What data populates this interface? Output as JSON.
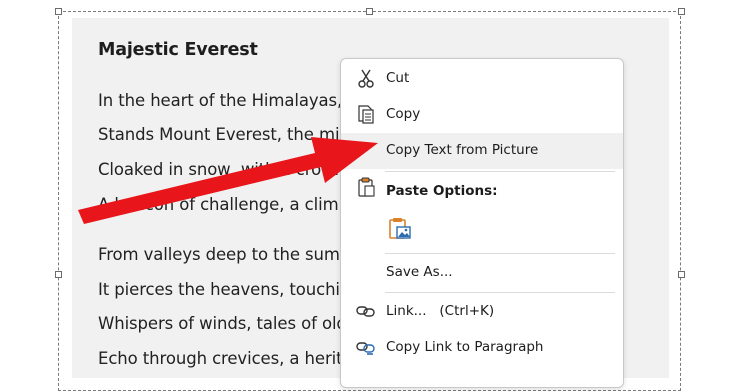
{
  "document": {
    "title": "Majestic Everest",
    "stanza1": [
      "In the heart of the Himalayas, where the",
      "Stands Mount Everest, the mighty",
      "Cloaked in snow, with a crown",
      "A beacon of challenge, a climb"
    ],
    "stanza2": [
      "From valleys deep to the summit",
      "It pierces the heavens, touching",
      "Whispers of winds, tales of old",
      "Echo through crevices, a heritage"
    ]
  },
  "context_menu": {
    "cut": {
      "label": "Cut",
      "icon": "scissors-icon"
    },
    "copy": {
      "label": "Copy",
      "icon": "copy-icon"
    },
    "copy_text_from_picture": {
      "label": "Copy Text from Picture",
      "highlighted": true
    },
    "paste_options": {
      "heading": "Paste Options:",
      "icon": "clipboard-icon",
      "option_icon": "paste-picture-icon"
    },
    "save_as": {
      "label": "Save As..."
    },
    "link": {
      "label": "Link...",
      "shortcut": "(Ctrl+K)",
      "icon": "link-icon"
    },
    "copy_link_to_paragraph": {
      "label": "Copy Link to Paragraph",
      "icon": "paragraph-link-icon"
    }
  },
  "annotation": {
    "arrow_color": "#e8161b",
    "points_to": "Copy Text from Picture"
  },
  "colors": {
    "menu_hover": "#f0f0f0",
    "picture_bg": "#f1f1f1",
    "icon_orange": "#d9822b",
    "icon_blue": "#2b6cb0"
  }
}
